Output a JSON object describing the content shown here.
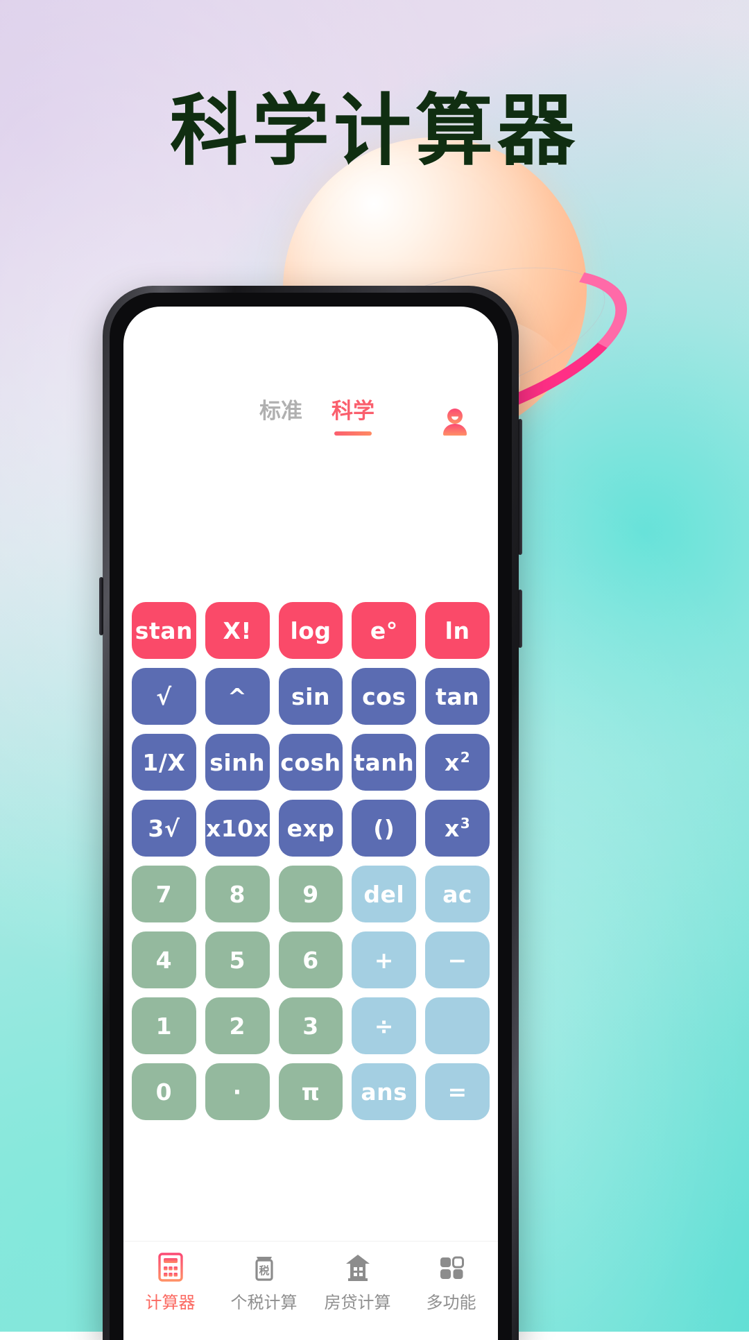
{
  "poster": {
    "title": "科学计算器",
    "title_color": "#102e11",
    "background_colors": [
      "#ded7ec",
      "#dfeaec",
      "#bfeae5",
      "#8fe4d9",
      "#7ae0d4"
    ],
    "decoration": {
      "planet_icon": "planet-icon",
      "planet_color": "#ffceab",
      "ring_color": "#ff2f86"
    }
  },
  "app": {
    "tabs": [
      {
        "label": "标准",
        "active": false,
        "color": "#b0b0b0"
      },
      {
        "label": "科学",
        "active": true,
        "color": "#fa5f6d"
      }
    ],
    "avatar_icon": "user-avatar-icon",
    "display_value": "",
    "keypad": {
      "rows": [
        {
          "style": "pink",
          "keys": [
            {
              "label": "stan"
            },
            {
              "label": "X!"
            },
            {
              "label": "log"
            },
            {
              "label": "e°"
            },
            {
              "label": "ln"
            }
          ]
        },
        {
          "style": "blue",
          "keys": [
            {
              "label": "√"
            },
            {
              "label": "^"
            },
            {
              "label": "sin"
            },
            {
              "label": "cos"
            },
            {
              "label": "tan"
            }
          ]
        },
        {
          "style": "blue",
          "keys": [
            {
              "label": "1/X"
            },
            {
              "label": "sinh"
            },
            {
              "label": "cosh"
            },
            {
              "label": "tanh"
            },
            {
              "label": "x",
              "sup": "2"
            }
          ]
        },
        {
          "style": "blue",
          "keys": [
            {
              "label": "3√"
            },
            {
              "label": "x10x"
            },
            {
              "label": "exp"
            },
            {
              "label": "()"
            },
            {
              "label": "x",
              "sup": "3"
            }
          ]
        },
        {
          "style": "mixed",
          "keys": [
            {
              "label": "7",
              "style": "green"
            },
            {
              "label": "8",
              "style": "green"
            },
            {
              "label": "9",
              "style": "green"
            },
            {
              "label": "del",
              "style": "cyan"
            },
            {
              "label": "ac",
              "style": "cyan"
            }
          ]
        },
        {
          "style": "mixed",
          "keys": [
            {
              "label": "4",
              "style": "green"
            },
            {
              "label": "5",
              "style": "green"
            },
            {
              "label": "6",
              "style": "green"
            },
            {
              "label": "+",
              "style": "cyan"
            },
            {
              "label": "−",
              "style": "cyan"
            }
          ]
        },
        {
          "style": "mixed",
          "keys": [
            {
              "label": "1",
              "style": "green"
            },
            {
              "label": "2",
              "style": "green"
            },
            {
              "label": "3",
              "style": "green"
            },
            {
              "label": "÷",
              "style": "cyan"
            },
            {
              "label": "",
              "style": "cyan"
            }
          ]
        },
        {
          "style": "mixed",
          "keys": [
            {
              "label": "0",
              "style": "green"
            },
            {
              "label": "·",
              "style": "green"
            },
            {
              "label": "π",
              "style": "green"
            },
            {
              "label": "ans",
              "style": "cyan"
            },
            {
              "label": "=",
              "style": "cyan"
            }
          ]
        }
      ],
      "colors": {
        "pink": "#fa4a69",
        "blue": "#5b6cb2",
        "green": "#94b99e",
        "cyan": "#a4cfe2"
      }
    },
    "bottom_nav": [
      {
        "label": "计算器",
        "icon": "calculator-icon",
        "active": true
      },
      {
        "label": "个税计算",
        "icon": "tax-icon",
        "active": false
      },
      {
        "label": "房贷计算",
        "icon": "house-icon",
        "active": false
      },
      {
        "label": "多功能",
        "icon": "grid-icon",
        "active": false
      }
    ],
    "bottom_nav_active_color": "#fb6a62",
    "bottom_nav_inactive_color": "#8f8f8f"
  }
}
